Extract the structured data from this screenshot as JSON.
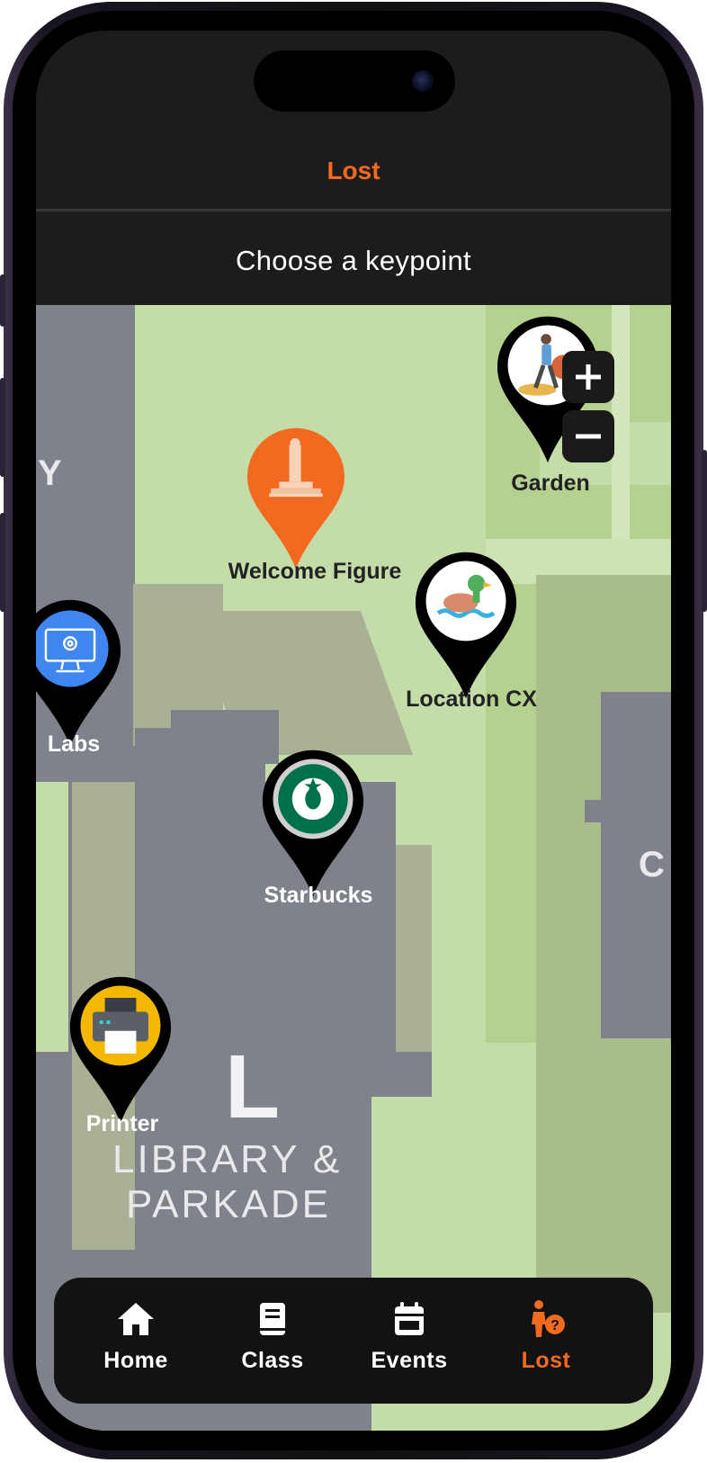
{
  "header": {
    "title": "Lost",
    "subtitle": "Choose a keypoint"
  },
  "colors": {
    "accent": "#f26a1f",
    "map_green": "#c4dca8",
    "building_gray": "#80828b"
  },
  "map": {
    "building_labels": {
      "left_partial": "Y",
      "library_letter": "L",
      "library_line1": "LIBRARY &",
      "library_line2": "PARKADE",
      "right_partial": "C"
    },
    "keypoints": [
      {
        "label": "Garden",
        "icon": "walking-person-icon"
      },
      {
        "label": "Welcome Figure",
        "icon": "monument-icon"
      },
      {
        "label": "Location CX",
        "icon": "duck-icon"
      },
      {
        "label": "Labs",
        "icon": "computer-settings-icon"
      },
      {
        "label": "Starbucks",
        "icon": "starbucks-logo-icon"
      },
      {
        "label": "Printer",
        "icon": "printer-icon"
      }
    ],
    "zoom": {
      "in_label": "+",
      "out_label": "−"
    }
  },
  "tabbar": {
    "items": [
      {
        "label": "Home",
        "icon": "home-icon"
      },
      {
        "label": "Class",
        "icon": "book-icon"
      },
      {
        "label": "Events",
        "icon": "calendar-icon"
      },
      {
        "label": "Lost",
        "icon": "lost-person-icon",
        "active": true
      }
    ]
  }
}
